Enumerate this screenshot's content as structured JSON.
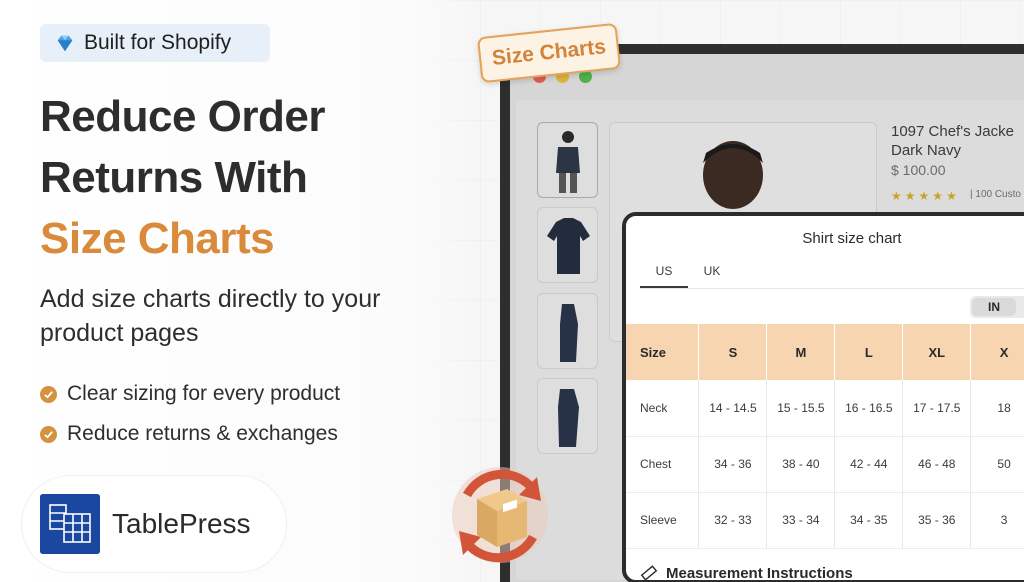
{
  "badge": {
    "label": "Built for Shopify",
    "icon": "diamond-icon"
  },
  "headline": {
    "line1": "Reduce Order",
    "line2": "Returns With",
    "accent": "Size Charts"
  },
  "subheadline": "Add size charts directly to your product pages",
  "bullets": [
    "Clear sizing for every product",
    "Reduce returns & exchanges"
  ],
  "brand": {
    "name": "TablePress",
    "logo": "table-logo-icon"
  },
  "tag": {
    "label": "Size Charts"
  },
  "product": {
    "title_line1": "1097 Chef's Jacke",
    "title_line2": "Dark Navy",
    "price": "$ 100.00",
    "reviews": "| 100 Custo"
  },
  "size_chart": {
    "title": "Shirt size chart",
    "tabs": [
      "US",
      "UK"
    ],
    "active_tab": "US",
    "unit": "IN",
    "headers": [
      "Size",
      "S",
      "M",
      "L",
      "XL",
      "X"
    ],
    "rows": [
      [
        "Neck",
        "14 - 14.5",
        "15 - 15.5",
        "16 - 16.5",
        "17 - 17.5",
        "18"
      ],
      [
        "Chest",
        "34 - 36",
        "38 - 40",
        "42 - 44",
        "46 - 48",
        "50"
      ],
      [
        "Sleeve",
        "32 - 33",
        "33 - 34",
        "34 - 35",
        "35 - 36",
        "3"
      ]
    ],
    "measurement_heading": "Measurement Instructions"
  },
  "colors": {
    "accent": "#d98a3a",
    "header_fill": "#f7d5b1",
    "brand_blue": "#1a47a0"
  }
}
